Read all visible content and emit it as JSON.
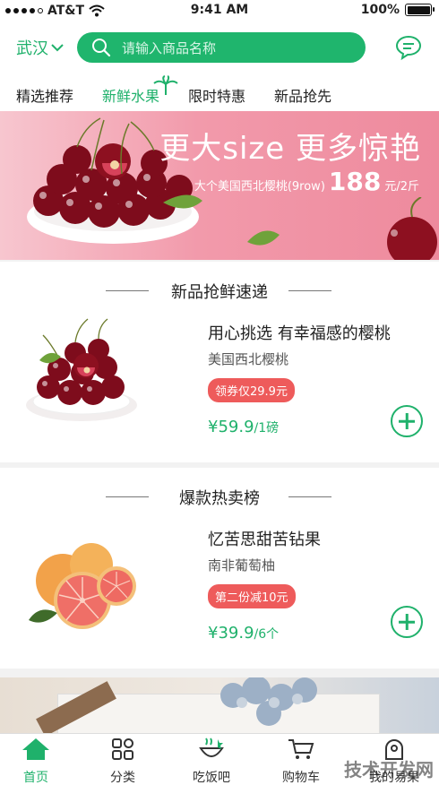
{
  "status_bar": {
    "carrier": "AT&T",
    "time": "9:41 AM",
    "battery": "100%"
  },
  "header": {
    "city": "武汉",
    "search_placeholder": "请输入商品名称"
  },
  "tabs": [
    "精选推荐",
    "新鲜水果",
    "限时特惠",
    "新品抢先"
  ],
  "active_tab": "新鲜水果",
  "banner": {
    "headline": "更大size 更多惊艳",
    "subtitle": "大个美国西北樱桃(9row)",
    "price": "188",
    "price_unit": "元/2斤"
  },
  "sections": [
    {
      "title": "新品抢鲜速递",
      "product": {
        "name": "用心挑选 有幸福感的樱桃",
        "desc": "美国西北樱桃",
        "badge": "领券仅29.9元",
        "price": "¥59.9",
        "unit": "/1磅"
      }
    },
    {
      "title": "爆款热卖榜",
      "product": {
        "name": "忆苦思甜苦钻果",
        "desc": "南非葡萄柚",
        "badge": "第二份减10元",
        "price": "¥39.9",
        "unit": "/6个"
      }
    }
  ],
  "tabbar": {
    "items": [
      "首页",
      "分类",
      "吃饭吧",
      "购物车",
      "我的易果"
    ],
    "active": "首页"
  },
  "watermark": "技术开发网",
  "colors": {
    "accent": "#1fb16b",
    "badge": "#ee5b5b",
    "banner": "#f29aab"
  }
}
